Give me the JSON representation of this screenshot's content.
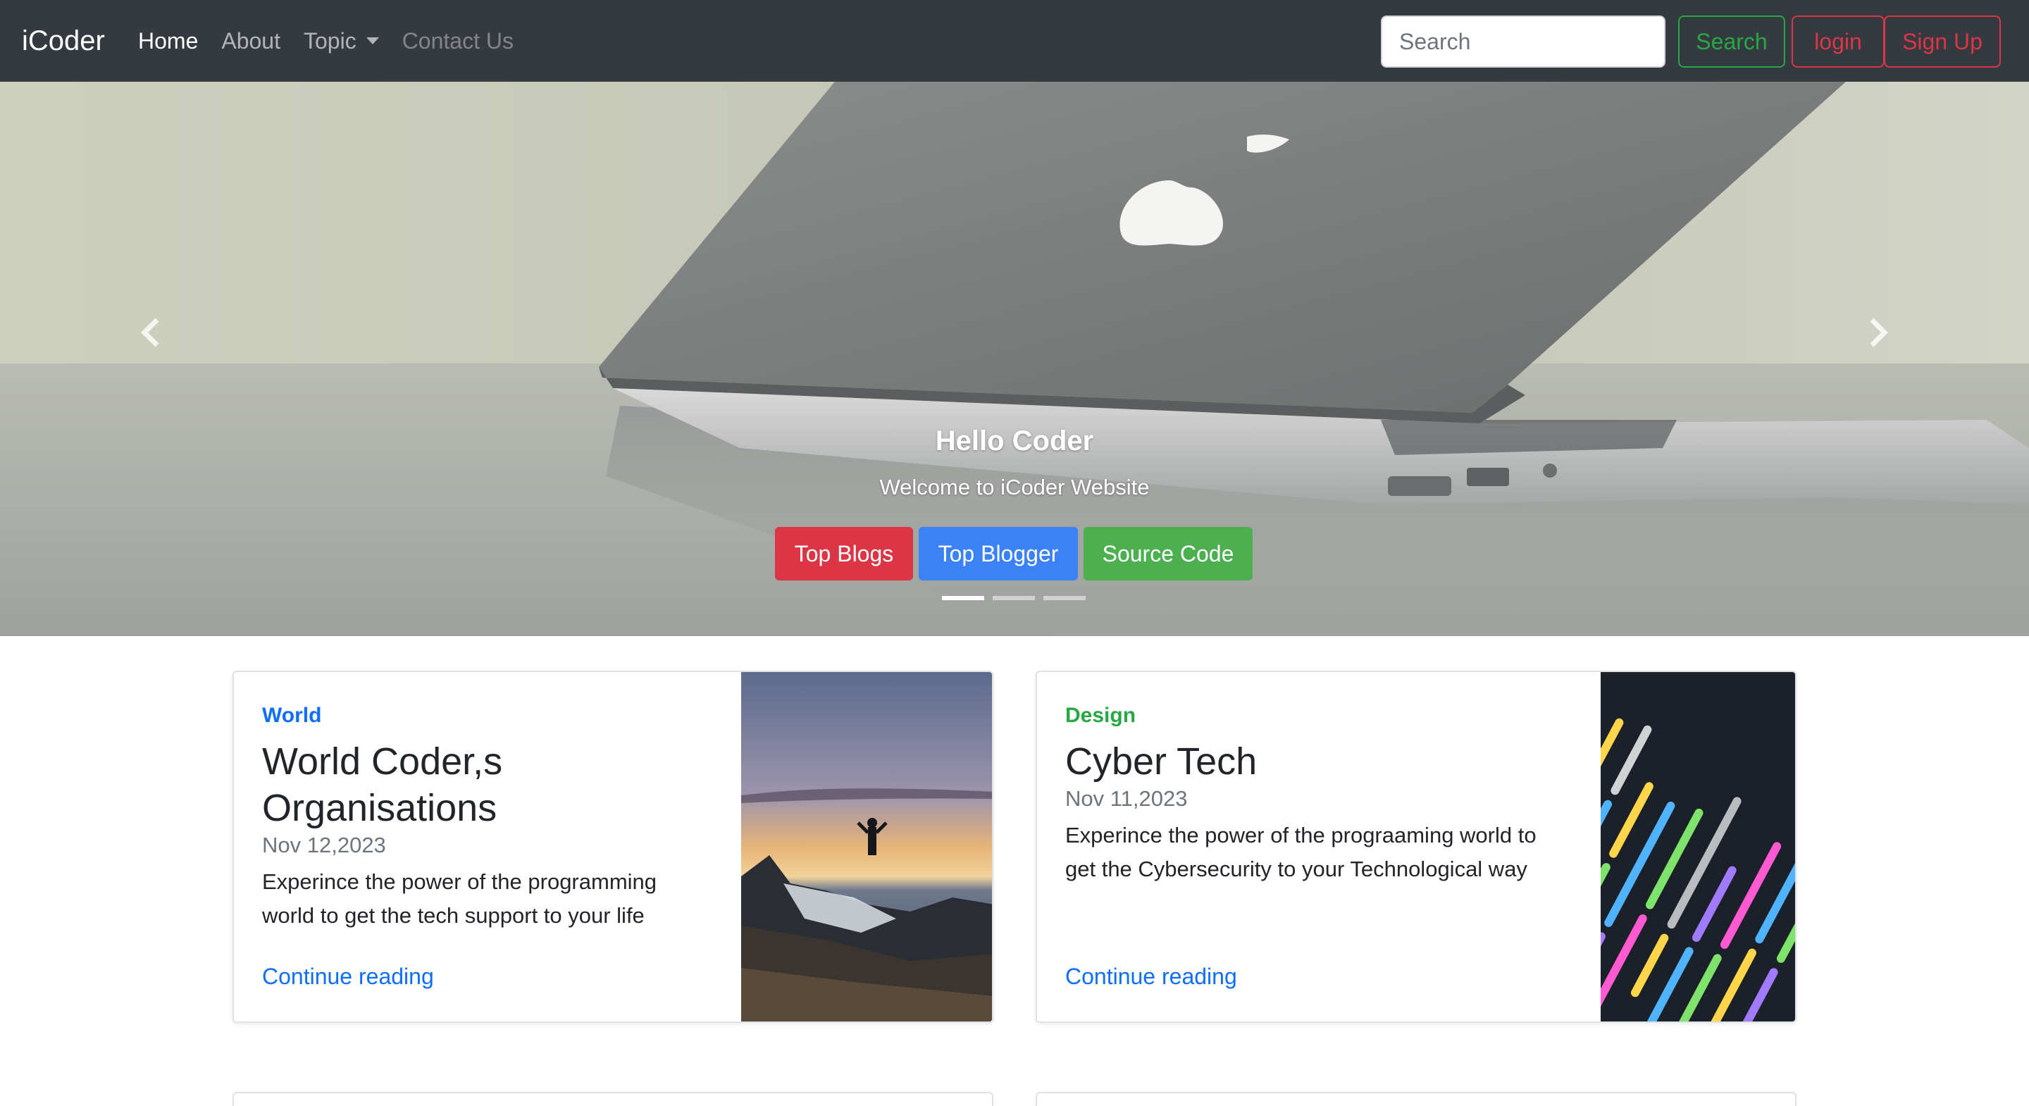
{
  "navbar": {
    "brand": "iCoder",
    "links": [
      {
        "label": "Home",
        "state": "active"
      },
      {
        "label": "About",
        "state": "normal"
      },
      {
        "label": "Topic",
        "state": "dropdown"
      },
      {
        "label": "Contact Us",
        "state": "disabled"
      }
    ],
    "search_placeholder": "Search",
    "search_button": "Search",
    "login_button": "login",
    "signup_button": "Sign Up",
    "colors": {
      "bg": "#343a40",
      "success": "#28a745",
      "danger": "#dc3545"
    }
  },
  "carousel": {
    "title": "Hello Coder",
    "subtitle": "Welcome to iCoder Website",
    "buttons": [
      "Top Blogs",
      "Top Blogger",
      "Source Code"
    ],
    "slides": 3,
    "active_slide": 1,
    "prev_icon": "chevron-left-icon",
    "next_icon": "chevron-right-icon"
  },
  "cards": [
    {
      "category": "World",
      "title_lines": [
        "World Coder,s",
        "Organisations"
      ],
      "date": "Nov 12,2023",
      "text_lines": [
        "Experince the power of the programming",
        "world to get the tech support to your life"
      ],
      "link": "Continue reading",
      "accent": "#0d6efd"
    },
    {
      "category": "Design",
      "title_lines": [
        "Cyber Tech"
      ],
      "date": "Nov 11,2023",
      "text_lines": [
        "Experince the power of the prograaming world to",
        "get the Cybersecurity to your Technological way"
      ],
      "link": "Continue reading",
      "accent": "#28a745"
    }
  ]
}
